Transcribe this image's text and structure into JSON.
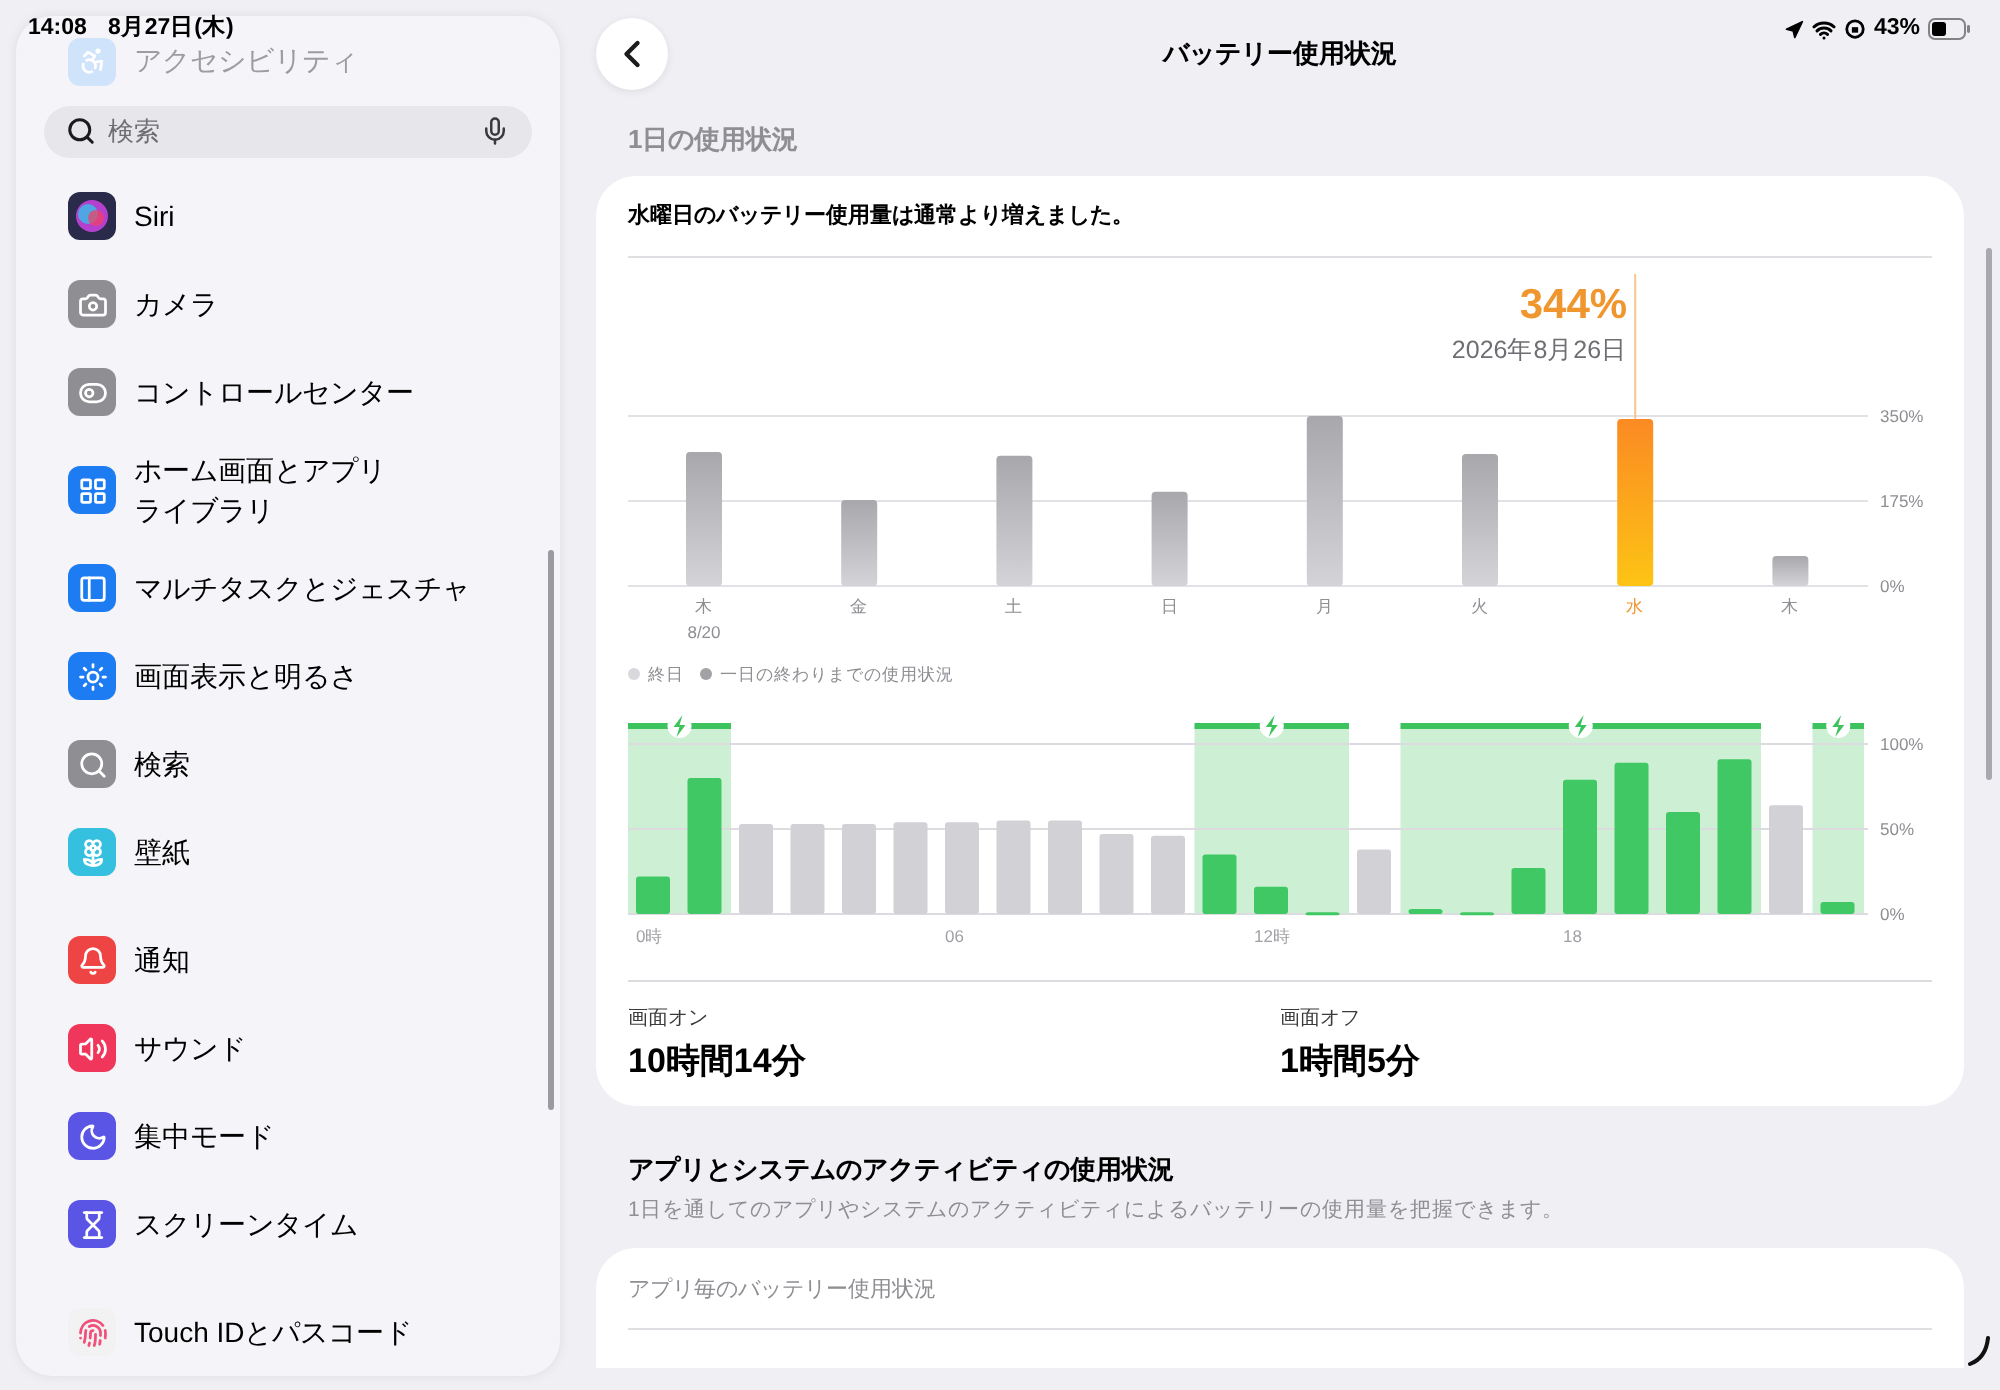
{
  "status_bar": {
    "time": "14:08",
    "date": "8月27日(木)",
    "battery": "43%"
  },
  "sidebar": {
    "faded_item": {
      "label": "アクセシビリティ",
      "kind": "accessibility",
      "color": "#cfe3fb",
      "faded": true
    },
    "search": {
      "placeholder": "検索"
    },
    "groups": [
      [
        {
          "label": "Siri",
          "kind": "siri",
          "color": "#2a2a4a"
        },
        {
          "label": "カメラ",
          "kind": "camera",
          "color": "#8e8e93"
        },
        {
          "label": "コントロールセンター",
          "kind": "control",
          "color": "#8e8e93"
        },
        {
          "label": "ホーム画面とアプリライブラリ",
          "kind": "home",
          "color": "#1e7cf2"
        },
        {
          "label": "マルチタスクとジェスチャ",
          "kind": "multitask",
          "color": "#1e7cf2"
        },
        {
          "label": "画面表示と明るさ",
          "kind": "display",
          "color": "#1e7cf2"
        },
        {
          "label": "検索",
          "kind": "search",
          "color": "#8e8e93"
        },
        {
          "label": "壁紙",
          "kind": "wallpaper",
          "color": "#35c0e0"
        }
      ],
      [
        {
          "label": "通知",
          "kind": "notification",
          "color": "#ef4444"
        },
        {
          "label": "サウンド",
          "kind": "sound",
          "color": "#f0365a"
        },
        {
          "label": "集中モード",
          "kind": "focus",
          "color": "#5b55e6"
        },
        {
          "label": "スクリーンタイム",
          "kind": "screentime",
          "color": "#5b55e6"
        }
      ],
      [
        {
          "label": "Touch IDとパスコード",
          "kind": "touchid",
          "color": "#f2f2f2"
        }
      ]
    ]
  },
  "header": {
    "title": "バッテリー使用状況"
  },
  "section_label": "1日の使用状況",
  "usage_card": {
    "message": "水曜日のバッテリー使用量は通常より増えました。",
    "daily": {
      "callout": {
        "value": "344%",
        "date": "2026年8月26日"
      },
      "days": [
        {
          "selected": false,
          "date": "8/20"
        },
        {
          "selected": false
        },
        {
          "selected": false
        },
        {
          "selected": false
        },
        {
          "selected": false
        },
        {
          "selected": false
        },
        {
          "selected": true
        },
        {
          "selected": false
        }
      ],
      "chart_data": {
        "type": "bar",
        "categories": [
          "木",
          "金",
          "土",
          "日",
          "月",
          "火",
          "水",
          "木"
        ],
        "values": [
          276,
          177,
          268,
          194,
          350,
          272,
          344,
          62
        ],
        "ylim": [
          0,
          350
        ],
        "yticks": [
          {
            "value": 0,
            "label": "0%"
          },
          {
            "value": 175,
            "label": "175%"
          },
          {
            "value": 350,
            "label": "350%"
          }
        ]
      },
      "legend": [
        {
          "label": "終日",
          "color": "#d9d9dd"
        },
        {
          "label": "一日の終わりまでの使用状況",
          "color": "#a1a1a6"
        }
      ]
    },
    "hourly": {
      "hour_labels": [
        "0時",
        "06",
        "12時",
        "18"
      ],
      "charging": [
        true,
        true,
        false,
        false,
        false,
        false,
        false,
        false,
        false,
        false,
        false,
        true,
        true,
        true,
        false,
        true,
        true,
        true,
        true,
        true,
        true,
        true,
        false,
        true
      ],
      "chart_data": {
        "type": "bar",
        "values": [
          22,
          80,
          53,
          53,
          53,
          54,
          54,
          55,
          55,
          47,
          46,
          35,
          16,
          1,
          38,
          3,
          1,
          27,
          79,
          89,
          60,
          91,
          64,
          7
        ],
        "ylim": [
          0,
          100
        ],
        "yticks": [
          {
            "value": 0,
            "label": "0%"
          },
          {
            "value": 50,
            "label": "50%"
          },
          {
            "value": 100,
            "label": "100%"
          }
        ]
      }
    },
    "stats": [
      {
        "label": "画面オン",
        "value": "10時間14分"
      },
      {
        "label": "画面オフ",
        "value": "1時間5分"
      }
    ]
  },
  "activity": {
    "title": "アプリとシステムのアクティビティの使用状況",
    "description": "1日を通してのアプリやシステムのアクティビティによるバッテリーの使用量を把握できます。"
  },
  "app_card": {
    "title": "アプリ毎のバッテリー使用状況"
  }
}
